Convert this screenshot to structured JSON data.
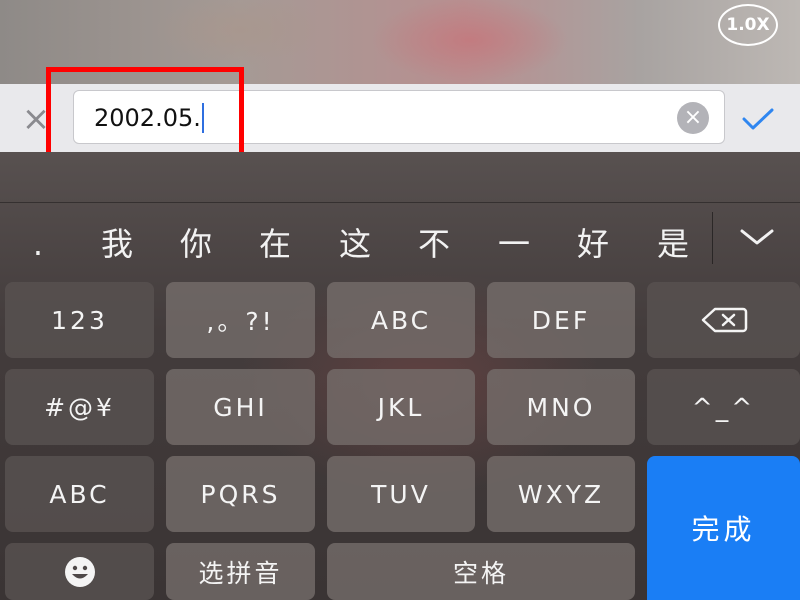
{
  "camera": {
    "zoom": "1.0X"
  },
  "input": {
    "value": "2002.05.",
    "clear_symbol": "×",
    "cancel_symbol": "×"
  },
  "candidates": [
    ".",
    "我",
    "你",
    "在",
    "这",
    "不",
    "一",
    "好",
    "是"
  ],
  "keyboard": {
    "row1": [
      "123",
      ",。?!",
      "ABC",
      "DEF"
    ],
    "row2": [
      "#@¥",
      "GHI",
      "JKL",
      "MNO",
      "^_^"
    ],
    "row3": [
      "ABC",
      "PQRS",
      "TUV",
      "WXYZ"
    ],
    "row4": [
      "选拼音",
      "空格"
    ],
    "enter_label": "完成"
  },
  "colors": {
    "accent": "#1a7ef5",
    "highlight": "#ff0000",
    "caret": "#2f6fe0"
  }
}
